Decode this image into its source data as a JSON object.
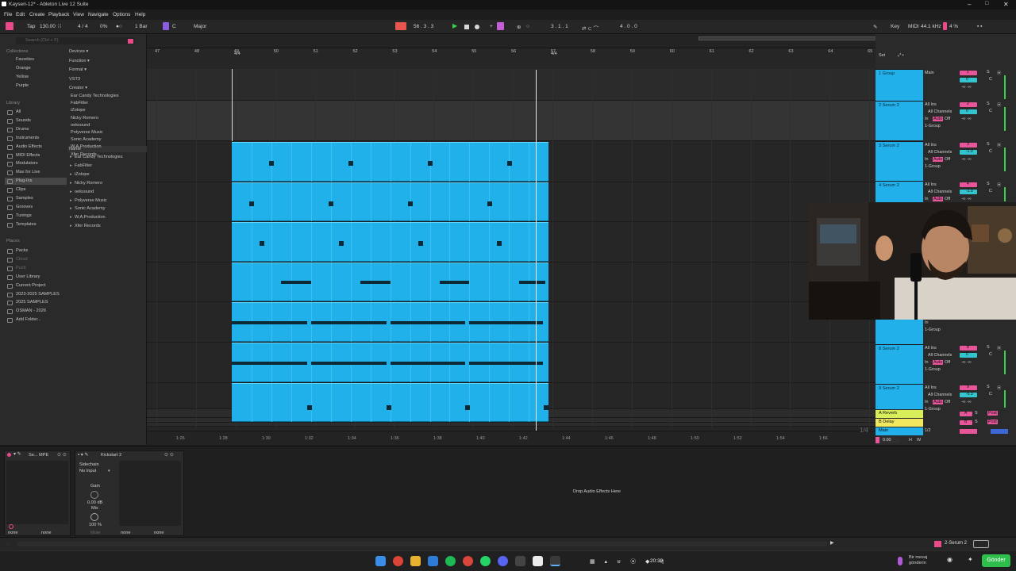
{
  "window": {
    "title": "Kayseri-12* - Ableton Live 12 Suite",
    "controls": [
      "–",
      "□",
      "✕"
    ]
  },
  "menu": [
    "File",
    "Edit",
    "Create",
    "Playback",
    "View",
    "Navigate",
    "Options",
    "Help"
  ],
  "transport": {
    "tap": "Tap",
    "tempo": "130.00",
    "time_sig": "4 / 4",
    "cpu_pct": "0%",
    "quantize": "1 Bar",
    "key_root": "C",
    "scale": "Major",
    "position": "56 .  3 .  3",
    "loop_start": "3 .  1 .  1",
    "loop_len": "4 .  0 .  0",
    "key_label": "Key",
    "midi_label": "MIDI",
    "sample_rate": "44.1 kHz",
    "cpu_load": "4 %"
  },
  "browser": {
    "search_placeholder": "Search (Ctrl + F)",
    "collections_header": "Collections",
    "collections": [
      {
        "label": "Favorites",
        "color": "#e8402e"
      },
      {
        "label": "Orange",
        "color": "#f08a24"
      },
      {
        "label": "Yellow",
        "color": "#e6d83a"
      },
      {
        "label": "Purple",
        "color": "#b45ad6"
      }
    ],
    "library_header": "Library",
    "library": [
      "All",
      "Sounds",
      "Drums",
      "Instruments",
      "Audio Effects",
      "MIDI Effects",
      "Modulators",
      "Max for Live",
      "Plug-Ins",
      "Clips",
      "Samples",
      "Grooves",
      "Tunings",
      "Templates"
    ],
    "selected_library": "Plug-Ins",
    "places_header": "Places",
    "places": [
      "Packs",
      "Cloud",
      "Push",
      "User Library",
      "Current Project",
      "2023-2025 SAMPLES",
      "2025 SAMPLES",
      "OSMAN - 2026",
      "Add Folder..."
    ],
    "filters": [
      "Devices ▾",
      "Function ▾",
      "Format ▾",
      "VST3",
      "Creator ▾"
    ],
    "creators": [
      "Ear Candy Technologies",
      "FabFilter",
      "iZotope",
      "Nicky Romero",
      "oeksound",
      "Polyverse Music",
      "Sonic Academy",
      "W.A.Production",
      "Xfer Records"
    ],
    "name_header": "Name",
    "name_list": [
      "Ear Candy Technologies",
      "FabFilter",
      "iZotope",
      "Nicky Romero",
      "oeksound",
      "Polyverse Music",
      "Sonic Academy",
      "W.A.Production",
      "Xfer Records"
    ]
  },
  "arrangement": {
    "bar_numbers": [
      "47",
      "48",
      "49",
      "50",
      "51",
      "52",
      "53",
      "54",
      "55",
      "56",
      "57",
      "58",
      "59",
      "60",
      "61",
      "62",
      "63",
      "64",
      "65"
    ],
    "time_sig_markers": [
      "4/4",
      "4/4"
    ],
    "time_ruler": [
      "1:26",
      "1:28",
      "1:30",
      "1:32",
      "1:34",
      "1:36",
      "1:38",
      "1:40",
      "1:42",
      "1:44",
      "1:46",
      "1:48",
      "1:50",
      "1:52",
      "1:54",
      "1:56"
    ],
    "clip_color": "#20b0ea",
    "zoom_label": "1/4"
  },
  "mixer": {
    "set_label": "Set",
    "tracks": [
      {
        "name": "1 Group",
        "input": "Main",
        "number": "1",
        "vol": "0",
        "pan": "C"
      },
      {
        "name": "2 Serum 2",
        "input": "All Ins",
        "channel": "All Channels",
        "monitor": [
          "In",
          "Auto",
          "Off"
        ],
        "route": "1-Group",
        "number": "2",
        "vol": "0",
        "pan": "C"
      },
      {
        "name": "3 Serum 2",
        "input": "All Ins",
        "channel": "All Channels",
        "monitor": [
          "In",
          "Auto",
          "Off"
        ],
        "route": "1-Group",
        "number": "3",
        "vol": "-1.0",
        "pan": "C"
      },
      {
        "name": "4 Serum 2",
        "input": "All Ins",
        "channel": "All Channels",
        "monitor": [
          "In",
          "Auto",
          "Off"
        ],
        "route": "1-Group",
        "number": "4",
        "vol": "-1.0",
        "pan": "C"
      },
      {
        "name": "8 Serum 2",
        "input": "All Ins",
        "channel": "All Channels",
        "monitor": [
          "In",
          "Auto",
          "Off"
        ],
        "route": "1-Group",
        "number": "8",
        "vol": "0",
        "pan": "C"
      },
      {
        "name": "9 Serum 2",
        "input": "All Ins",
        "channel": "All Channels",
        "monitor": [
          "In",
          "Auto",
          "Off"
        ],
        "route": "1-Group",
        "number": "9",
        "vol": "-5.3",
        "pan": "C"
      }
    ],
    "returns": [
      {
        "name": "A Reverb",
        "letter": "A",
        "post": "Post"
      },
      {
        "name": "B Delay",
        "letter": "B",
        "post": "Post"
      }
    ],
    "main": {
      "name": "Main",
      "route": "1/2",
      "vol": "0.00",
      "solo_label": "H",
      "w_label": "W"
    }
  },
  "devices": {
    "device1": {
      "title": "Se... MPE",
      "in": "none",
      "out": "none"
    },
    "kickstart": {
      "title": "Kickstart 2",
      "sidechain_label": "Sidechain",
      "input_value": "No Input",
      "gain_label": "Gain",
      "gain_value": "0.00 dB",
      "mix_label": "Mix",
      "mix_value": "100 %",
      "mute": "Mute",
      "in": "none",
      "out": "none"
    },
    "drop_hint": "Drop Audio Effects Here"
  },
  "statusbar": {
    "selected_track": "2-Serum 2"
  },
  "taskbar": {
    "time": "20:39",
    "message_placeholder": "Bir mesaj gönderin",
    "send_button": "Gönder"
  }
}
